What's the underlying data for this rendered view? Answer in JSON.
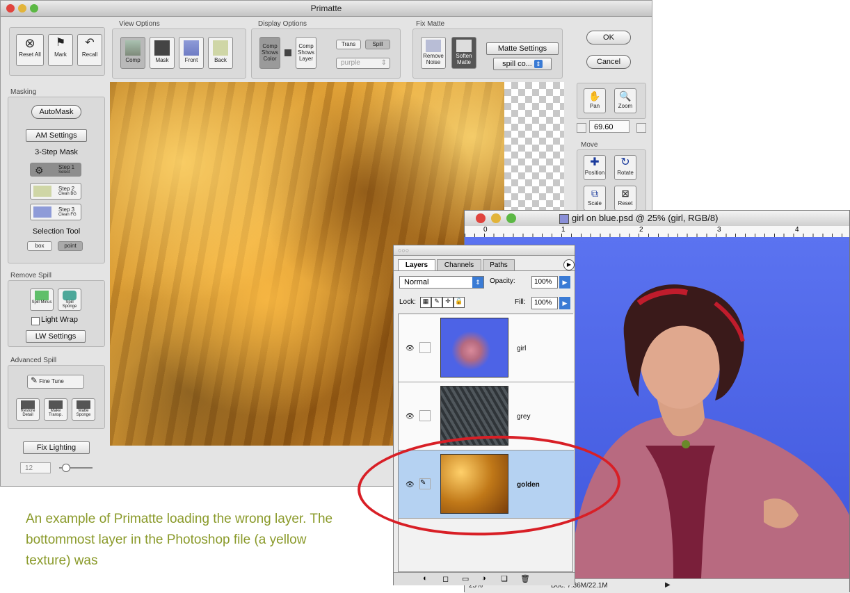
{
  "primatte": {
    "title": "Primatte",
    "top_toolbar": {
      "reset_all": "Reset All",
      "mark": "Mark",
      "recall": "Recall"
    },
    "view_options": {
      "label": "View Options",
      "buttons": [
        "Comp",
        "Mask",
        "Front",
        "Back"
      ]
    },
    "display_options": {
      "label": "Display Options",
      "comp_shows_color": "Comp Shows Color",
      "comp_shows_layer": "Comp Shows Layer",
      "trans": "Trans",
      "spill": "Spill",
      "color_select": "purple"
    },
    "fix_matte": {
      "label": "Fix Matte",
      "remove_noise": "Remove Noise",
      "soften_matte": "Soften Matte",
      "matte_settings": "Matte Settings",
      "matte_select": "spill co..."
    },
    "ok": "OK",
    "cancel": "Cancel",
    "masking": {
      "label": "Masking",
      "automask": "AutoMask",
      "am_settings": "AM Settings",
      "three_step": "3-Step Mask",
      "step1_title": "Step 1",
      "step1_sub": "Select",
      "step2_title": "Step 2",
      "step2_sub": "Clean BG",
      "step3_title": "Step 3",
      "step3_sub": "Clean FG",
      "selection_tool": "Selection Tool",
      "box": "box",
      "point": "point"
    },
    "remove_spill": {
      "label": "Remove Spill",
      "spill_minus": "Spill Minus",
      "spill_sponge": "Spill Sponge",
      "light_wrap": "Light Wrap",
      "lw_settings": "LW Settings"
    },
    "advanced_spill": {
      "label": "Advanced Spill",
      "fine_tune": "Fine Tune",
      "restore_detail": "Restore Detail",
      "make_transp": "Make Transp.",
      "matte_sponge": "Matte Sponge"
    },
    "fix_lighting": "Fix Lighting",
    "lighting_value": "12",
    "right_tools": {
      "pan": "Pan",
      "zoom": "Zoom",
      "zoom_value": "69.60",
      "move_label": "Move",
      "position": "Position",
      "rotate": "Rotate",
      "scale": "Scale",
      "reset": "Reset"
    }
  },
  "photoshop": {
    "title": "girl on blue.psd @ 25% (girl, RGB/8)",
    "ruler_marks": [
      "0",
      "1",
      "2",
      "3",
      "4"
    ],
    "zoom": "25%",
    "doc": "Doc: 7.36M/22.1M"
  },
  "layers_palette": {
    "tabs": [
      "Layers",
      "Channels",
      "Paths"
    ],
    "blend_mode": "Normal",
    "opacity_label": "Opacity:",
    "opacity": "100%",
    "lock_label": "Lock:",
    "fill_label": "Fill:",
    "fill": "100%",
    "layers": [
      {
        "name": "girl"
      },
      {
        "name": "grey"
      },
      {
        "name": "golden"
      }
    ]
  },
  "caption": "An example of Primatte loading the wrong layer. The bottommost layer in the Photoshop file (a yellow texture) was",
  "colors": {
    "highlight_circle": "#d81f26",
    "caption_text": "#8a9a2a",
    "blue_backdrop": "#4d63e6"
  }
}
